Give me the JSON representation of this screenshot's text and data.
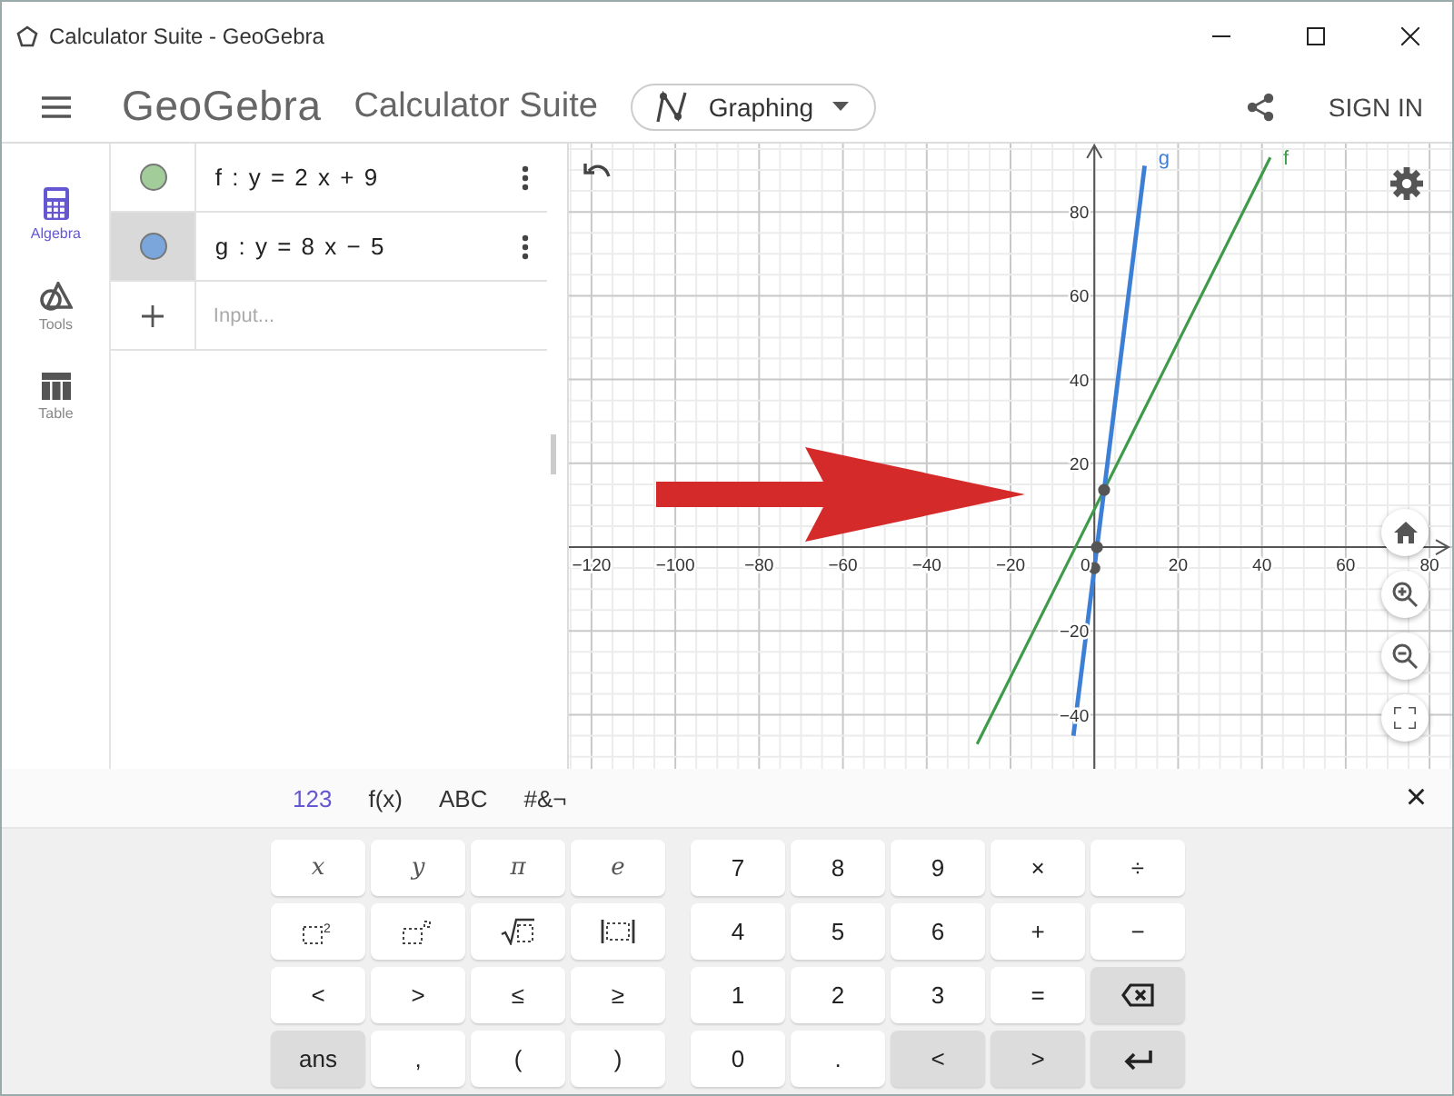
{
  "window": {
    "title": "Calculator Suite - GeoGebra"
  },
  "header": {
    "logo": "GeoGebra",
    "title": "Calculator Suite",
    "app_switcher": "Graphing",
    "sign_in": "SIGN IN"
  },
  "sidebar": {
    "items": [
      {
        "label": "Algebra",
        "kind": "algebra",
        "selected": true
      },
      {
        "label": "Tools",
        "kind": "tools",
        "selected": false
      },
      {
        "label": "Table",
        "kind": "table",
        "selected": false
      }
    ]
  },
  "algebra": {
    "items": [
      {
        "expression": "f : y = 2 x + 9",
        "color": "#a3cc9b",
        "selected": false
      },
      {
        "expression": "g : y = 8 x − 5",
        "color": "#7aa6dc",
        "selected": true
      }
    ],
    "input": {
      "placeholder": "Input..."
    }
  },
  "graph": {
    "chart_data": {
      "type": "line",
      "grid": true,
      "x": [
        -28,
        -5,
        12,
        42
      ],
      "series": [
        {
          "name": "f",
          "color": "#3f9a4a",
          "values": [
            -47,
            -1,
            33,
            93
          ]
        },
        {
          "name": "g",
          "color": "#3d7fd6",
          "values": [
            null,
            -45,
            91,
            null
          ]
        }
      ],
      "xlim": [
        -125.4,
        85.4
      ],
      "ylim": [
        -52.9,
        96.3
      ],
      "xticks": [
        {
          "value": -120,
          "label": "−120"
        },
        {
          "value": -100,
          "label": "−100"
        },
        {
          "value": -80,
          "label": "−80"
        },
        {
          "value": -60,
          "label": "−60"
        },
        {
          "value": -40,
          "label": "−40"
        },
        {
          "value": -20,
          "label": "−20"
        },
        {
          "value": 0,
          "label": "0"
        },
        {
          "value": 20,
          "label": "20"
        },
        {
          "value": 40,
          "label": "40"
        },
        {
          "value": 60,
          "label": "60"
        },
        {
          "value": 80,
          "label": "80"
        }
      ],
      "yticks": [
        {
          "value": -40,
          "label": "−40"
        },
        {
          "value": -20,
          "label": "−20"
        },
        {
          "value": 20,
          "label": "20"
        },
        {
          "value": 40,
          "label": "40"
        },
        {
          "value": 60,
          "label": "60"
        },
        {
          "value": 80,
          "label": "80"
        }
      ]
    }
  },
  "keyboard": {
    "tabs": [
      {
        "label": "123",
        "selected": true
      },
      {
        "label": "f(x)",
        "selected": false
      },
      {
        "label": "ABC",
        "selected": false
      },
      {
        "label": "#&¬",
        "selected": false
      }
    ],
    "close": "×",
    "left_rows": [
      [
        {
          "kind": "var",
          "label": "x"
        },
        {
          "kind": "var",
          "label": "y"
        },
        {
          "kind": "var",
          "label": "π"
        },
        {
          "kind": "var",
          "label": "e"
        }
      ],
      [
        {
          "kind": "square",
          "label": "2"
        },
        {
          "kind": "power"
        },
        {
          "kind": "sqrt"
        },
        {
          "kind": "abs"
        }
      ],
      [
        {
          "kind": "text",
          "label": "<"
        },
        {
          "kind": "text",
          "label": ">"
        },
        {
          "kind": "text",
          "label": "≤"
        },
        {
          "kind": "text",
          "label": "≥"
        }
      ],
      [
        {
          "kind": "nav",
          "label": "ans"
        },
        {
          "kind": "text",
          "label": ","
        },
        {
          "kind": "text",
          "label": "("
        },
        {
          "kind": "text",
          "label": ")"
        }
      ]
    ],
    "right_rows": [
      [
        {
          "kind": "text",
          "label": "7"
        },
        {
          "kind": "text",
          "label": "8"
        },
        {
          "kind": "text",
          "label": "9"
        },
        {
          "kind": "text",
          "label": "×"
        },
        {
          "kind": "text",
          "label": "÷"
        }
      ],
      [
        {
          "kind": "text",
          "label": "4"
        },
        {
          "kind": "text",
          "label": "5"
        },
        {
          "kind": "text",
          "label": "6"
        },
        {
          "kind": "text",
          "label": "+"
        },
        {
          "kind": "text",
          "label": "−"
        }
      ],
      [
        {
          "kind": "text",
          "label": "1"
        },
        {
          "kind": "text",
          "label": "2"
        },
        {
          "kind": "text",
          "label": "3"
        },
        {
          "kind": "text",
          "label": "="
        },
        {
          "kind": "backspace"
        }
      ],
      [
        {
          "kind": "text",
          "label": "0"
        },
        {
          "kind": "text",
          "label": "."
        },
        {
          "kind": "nav",
          "label": "<"
        },
        {
          "kind": "nav",
          "label": ">"
        },
        {
          "kind": "enter"
        }
      ]
    ]
  }
}
